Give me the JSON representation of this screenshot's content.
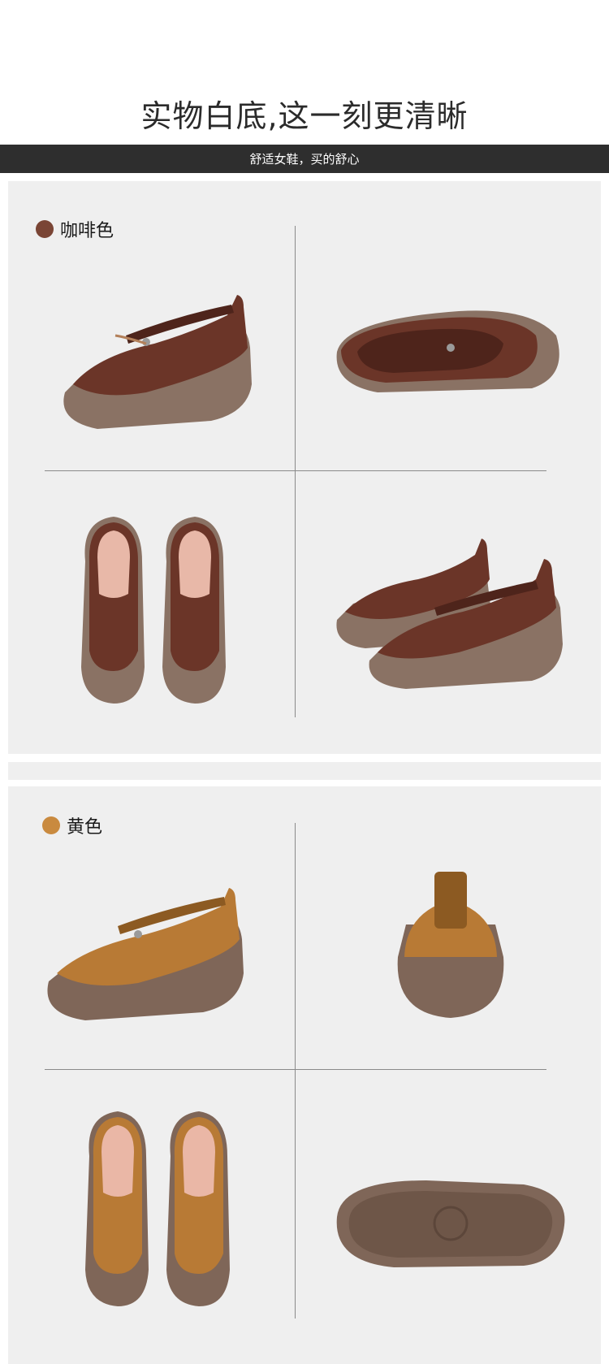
{
  "headline": "实物白底,这一刻更清晰",
  "banner": "舒适女鞋，买的舒心",
  "variants": [
    {
      "label": "咖啡色",
      "swatch": "#7a4535",
      "upper": "#6b3528",
      "upper_dark": "#4e241b",
      "sole": "#8a7264",
      "lining": "#e8b8a8"
    },
    {
      "label": "黄色",
      "swatch": "#c98a3f",
      "upper": "#b87a35",
      "upper_dark": "#8c5a22",
      "sole": "#7f6658",
      "lining": "#eab7a6"
    }
  ]
}
